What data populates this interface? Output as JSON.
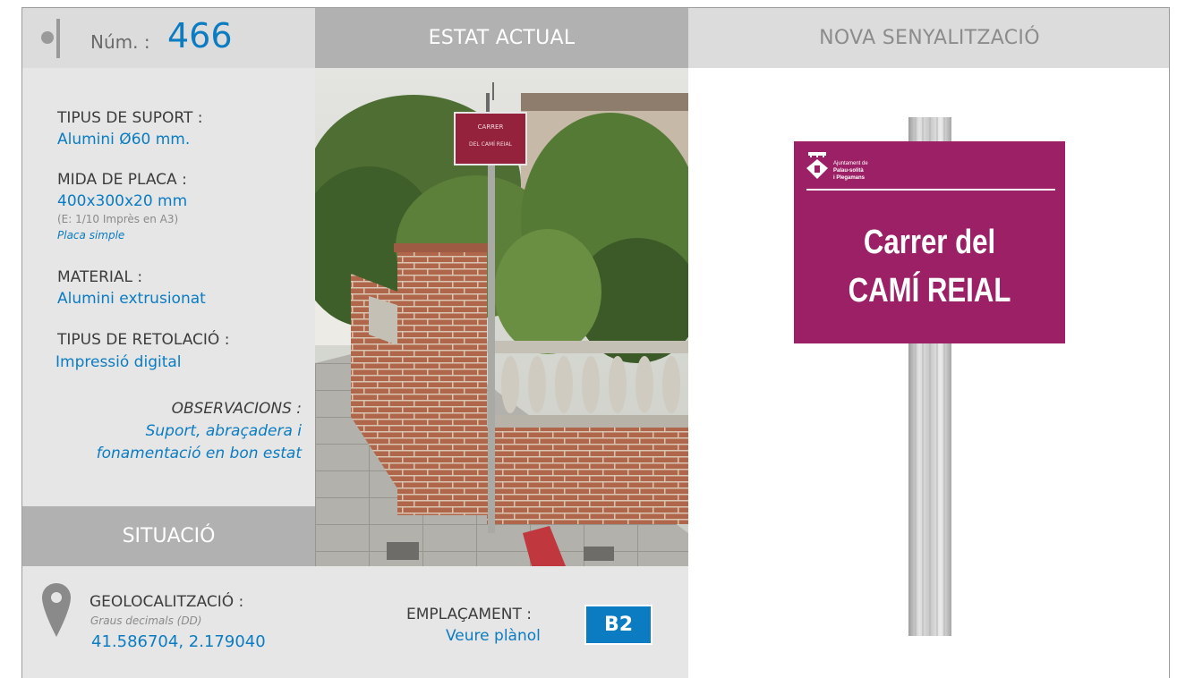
{
  "header": {
    "num_label": "Núm. :",
    "num_value": "466",
    "estat_title": "ESTAT ACTUAL",
    "nova_title": "NOVA SENYALITZACIÓ"
  },
  "info": {
    "suport_label": "TIPUS DE SUPORT :",
    "suport_value": "Alumini Ø60 mm.",
    "mida_label": "MIDA DE PLACA :",
    "mida_value": "400x300x20 mm",
    "mida_note": "(E: 1/10 Imprès en A3)",
    "mida_type": "Placa simple",
    "material_label": "MATERIAL :",
    "material_value": "Alumini extrusionat",
    "retolacio_label": "TIPUS DE RETOLACIÓ :",
    "retolacio_value": "Impressió digital",
    "obs_label": "OBSERVACIONS :",
    "obs_line1": "Suport, abraçadera i",
    "obs_line2": "fonamentació en bon estat"
  },
  "situacio": {
    "title": "SITUACIÓ",
    "geo_label": "GEOLOCALITZACIÓ :",
    "geo_note": "Graus decimals (DD)",
    "geo_value": "41.586704, 2.179040",
    "empl_label": "EMPLAÇAMENT :",
    "empl_link": "Veure plànol",
    "empl_code": "B2"
  },
  "photo_sign": {
    "line1": "CARRER",
    "line2": "DEL CAMÍ REIAL"
  },
  "new_sign": {
    "org_line1": "Ajuntament de",
    "org_line2": "Palau-solità",
    "org_line3": "i Plegamans",
    "title_line1": "Carrer del",
    "title_line2": "CAMÍ REIAL"
  },
  "colors": {
    "accent_blue": "#0b7cc1",
    "sign_magenta": "#9c2066",
    "header_gray": "#b1b1b1",
    "panel_gray": "#e6e6e6"
  }
}
